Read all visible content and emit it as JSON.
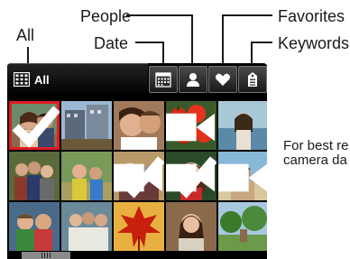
{
  "callouts": {
    "all": "All",
    "date": "Date",
    "people": "People",
    "favorites": "Favorites",
    "keywords": "Keywords"
  },
  "tabs": {
    "all_label": "All",
    "active_tab": "all",
    "buttons": [
      {
        "id": "date",
        "icon": "calendar-icon"
      },
      {
        "id": "people",
        "icon": "person-icon"
      },
      {
        "id": "favorites",
        "icon": "heart-icon"
      },
      {
        "id": "keywords",
        "icon": "tag-icon"
      }
    ]
  },
  "grid": {
    "rows": 4,
    "columns": 5,
    "selected_index": 0,
    "checked_indices": [
      0,
      7,
      8
    ],
    "video_indices": [
      3,
      7,
      8,
      9
    ]
  },
  "note": {
    "line1": "For best re",
    "line2": "camera da"
  },
  "colors": {
    "selection": "#e11b22",
    "background": "#000000"
  }
}
